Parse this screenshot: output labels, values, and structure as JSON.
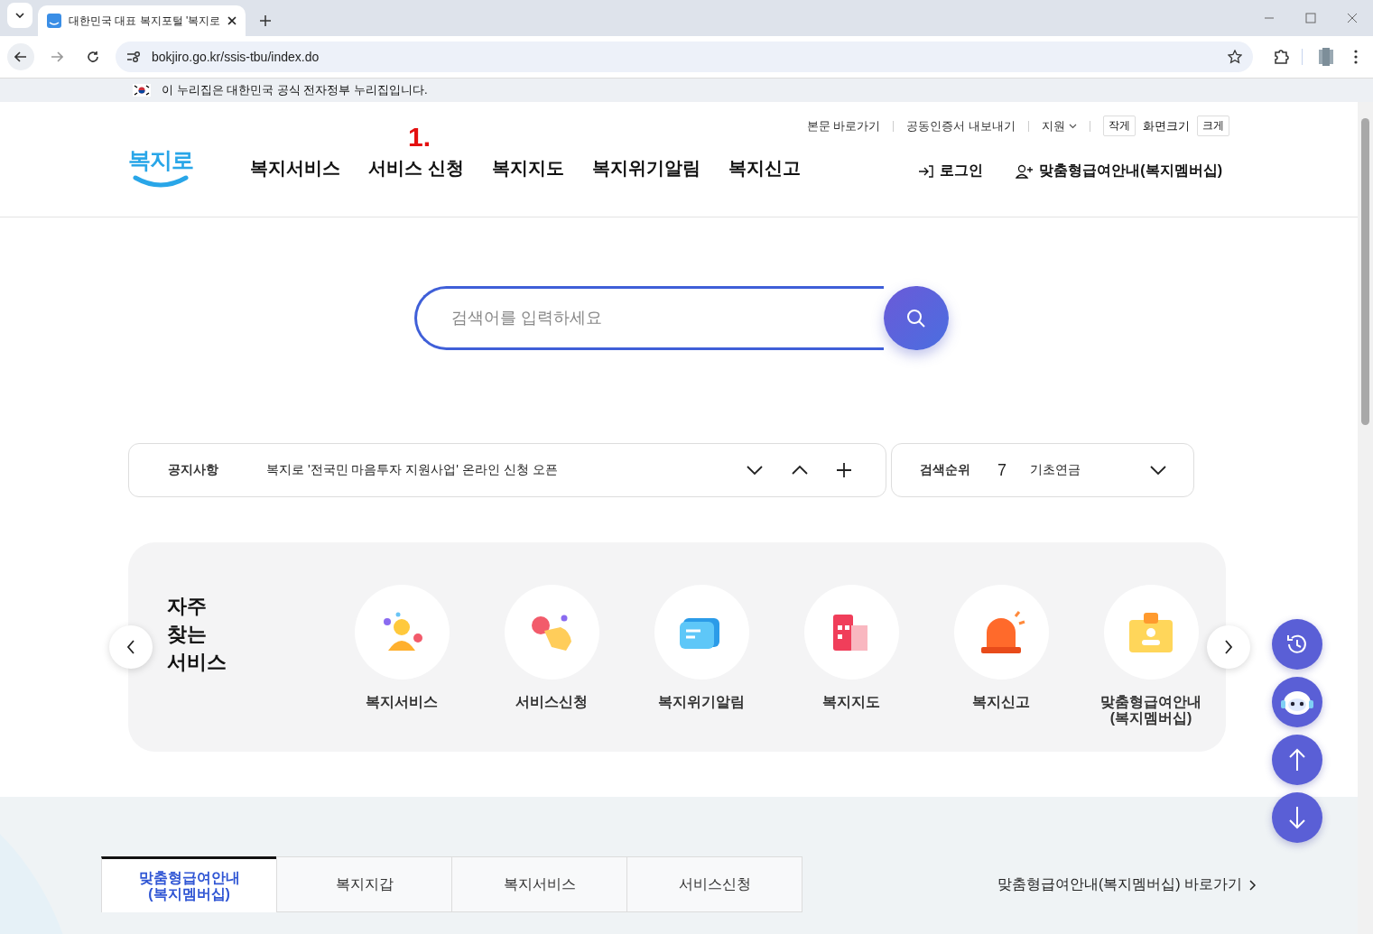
{
  "browser": {
    "tab_title": "대한민국 대표 복지포털 '복지로",
    "url": "bokjiro.go.kr/ssis-tbu/index.do"
  },
  "gov_banner": "이 누리집은 대한민국 공식 전자정부 누리집입니다.",
  "header": {
    "logo": "복지로",
    "util_links": [
      {
        "label": "본문 바로가기",
        "kind": "link"
      },
      {
        "label": "공동인증서 내보내기",
        "kind": "link"
      },
      {
        "label": "지원",
        "kind": "dropdown"
      }
    ],
    "font_size": {
      "smaller": "작게",
      "label": "화면크기",
      "larger": "크게"
    },
    "nav": [
      "복지서비스",
      "서비스 신청",
      "복지지도",
      "복지위기알림",
      "복지신고"
    ],
    "annotation": "1.",
    "login": "로그인",
    "membership": "맞춤형급여안내(복지멤버십)"
  },
  "search": {
    "placeholder": "검색어를 입력하세요"
  },
  "notice": {
    "label": "공지사항",
    "text": "복지로 '전국민 마음투자 지원사업' 온라인 신청 오픈"
  },
  "ranking": {
    "label": "검색순위",
    "rank": "7",
    "term": "기초연금"
  },
  "quick": {
    "title": "자주 찾는 서비스",
    "items": [
      {
        "label": "복지서비스",
        "kind": "person"
      },
      {
        "label": "서비스신청",
        "kind": "hand"
      },
      {
        "label": "복지위기알림",
        "kind": "message"
      },
      {
        "label": "복지지도",
        "kind": "map"
      },
      {
        "label": "복지신고",
        "kind": "siren"
      },
      {
        "label": "맞춤형급여안내(복지멤버십)",
        "kind": "card"
      }
    ]
  },
  "bottom_tabs": [
    {
      "label": "맞춤형급여안내(복지멤버십)",
      "selected": true
    },
    {
      "label": "복지지갑",
      "selected": false
    },
    {
      "label": "복지서비스",
      "selected": false
    },
    {
      "label": "서비스신청",
      "selected": false
    }
  ],
  "bottom_link": "맞춤형급여안내(복지멤버십) 바로가기"
}
